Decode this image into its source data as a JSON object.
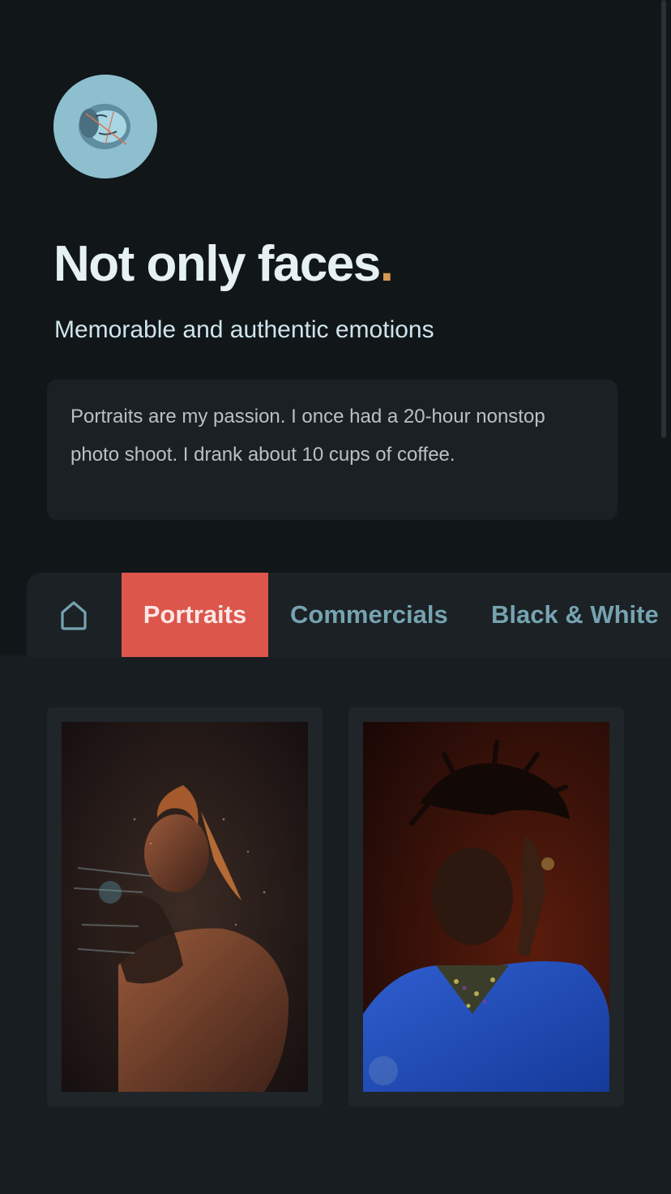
{
  "hero": {
    "headline": "Not only faces",
    "headline_dot": ".",
    "subtitle": "Memorable and authentic emotions",
    "bio": "Portraits are my passion. I once had a 20-hour nonstop photo shoot. I drank about 10 cups of coffee."
  },
  "nav": {
    "home_icon": "home-icon",
    "tabs": [
      {
        "label": "Portraits",
        "active": true
      },
      {
        "label": "Commercials",
        "active": false
      },
      {
        "label": "Black & White",
        "active": false
      }
    ]
  },
  "gallery": {
    "photos": [
      {
        "subject": "portrait-golden-body-paint"
      },
      {
        "subject": "portrait-blue-shirt"
      }
    ]
  },
  "colors": {
    "accent": "#dc564b",
    "headline_dot": "#d49a52",
    "tab_text": "#76a3b0",
    "background": "#111619"
  }
}
